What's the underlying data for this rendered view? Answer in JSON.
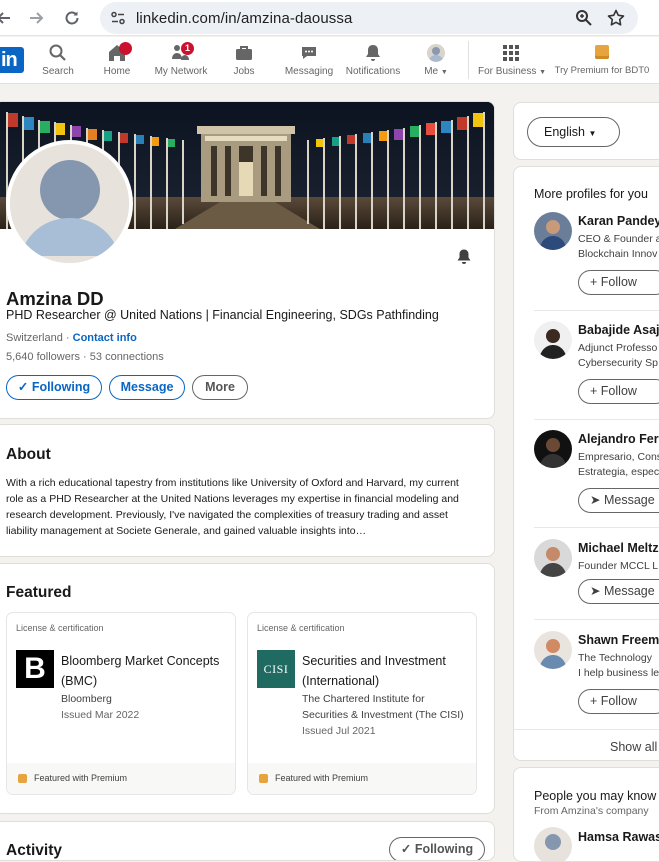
{
  "browser": {
    "url": "linkedin.com/in/amzina-daoussa",
    "icons": [
      "back-icon",
      "forward-icon",
      "reload-icon",
      "site-info-icon",
      "zoom-icon",
      "bookmark-star-icon"
    ]
  },
  "nav": {
    "logo": "in",
    "items": [
      {
        "label": "Search",
        "icon": "search-icon"
      },
      {
        "label": "Home",
        "icon": "home-icon"
      },
      {
        "label": "My Network",
        "icon": "network-icon",
        "badge": "1"
      },
      {
        "label": "Jobs",
        "icon": "briefcase-icon"
      },
      {
        "label": "Messaging",
        "icon": "messaging-icon"
      },
      {
        "label": "Notifications",
        "icon": "bell-icon"
      },
      {
        "label": "Me",
        "icon": "avatar-icon"
      },
      {
        "label": "For Business",
        "icon": "grid-icon"
      },
      {
        "label": "Try Premium for BDT0",
        "icon": "premium-icon"
      }
    ]
  },
  "profile": {
    "name": "Amzina DD",
    "headline": "PHD Researcher @ United Nations | Financial Engineering, SDGs Pathfinding",
    "location": "Switzerland",
    "separator": " · ",
    "contact_label": "Contact info",
    "followers": "5,640 followers",
    "connections": "53 connections",
    "actions": {
      "following": "Following",
      "message": "Message",
      "more": "More"
    }
  },
  "about": {
    "title": "About",
    "text": "With a rich educational tapestry from institutions like University of Oxford and Harvard, my current role as a PHD Researcher at the United Nations leverages my expertise in financial modeling and research development. Previously, I've navigated the complexities of treasury trading and asset liability management at Societe Generale, and gained valuable insights into…"
  },
  "featured": {
    "title": "Featured",
    "items": [
      {
        "type": "License & certification",
        "title": "Bloomberg Market Concepts (BMC)",
        "issuer": "Bloomberg",
        "date": "Issued Mar 2022",
        "logo_text": "B",
        "footer": "Featured with Premium"
      },
      {
        "type": "License & certification",
        "title": "Securities and Investment (International)",
        "issuer": "The Chartered Institute for Securities & Investment (The CISI)",
        "date": "Issued Jul 2021",
        "logo_text": "CISI",
        "footer": "Featured with Premium"
      }
    ]
  },
  "activity": {
    "title": "Activity",
    "button": "Following"
  },
  "sidebar": {
    "language": "English",
    "more_profiles_title": "More profiles for you",
    "profiles": [
      {
        "name": "Karan Pandey",
        "line1": "CEO & Founder a",
        "line2": "Blockchain Innov",
        "action": "Follow"
      },
      {
        "name": "Babajide Asaju",
        "line1": "Adjunct Professo",
        "line2": "Cybersecurity Sp",
        "action": "Follow"
      },
      {
        "name": "Alejandro Ferr",
        "line1": "Empresario, Cons",
        "line2": "Estrategia, espec",
        "action": "Message"
      },
      {
        "name": "Michael Meltz",
        "line1": "Founder MCCL L",
        "line2": "",
        "action": "Message"
      },
      {
        "name": "Shawn Freema",
        "line1": "The Technology",
        "line2": "I help business le",
        "action": "Follow"
      }
    ],
    "show_all": "Show all",
    "pymk_title": "People you may know",
    "pymk_subtitle": "From Amzina's company",
    "pymk_first": "Hamsa Rawas"
  },
  "colors": {
    "brand": "#0a66c2",
    "badge": "#cb112d",
    "premium": "#e7a33e",
    "page_bg": "#f4f2ee"
  }
}
